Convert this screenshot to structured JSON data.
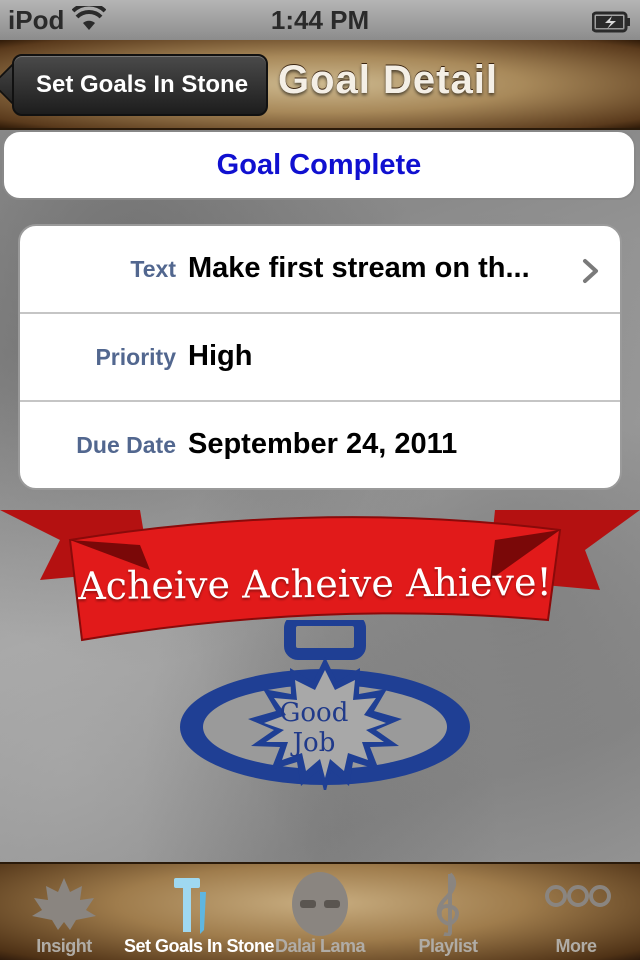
{
  "status_bar": {
    "carrier": "iPod",
    "time": "1:44 PM"
  },
  "nav": {
    "back_label": "Set Goals In Stone",
    "title": "Goal Detail"
  },
  "goal_complete_label": "Goal Complete",
  "detail": {
    "rows": [
      {
        "label": "Text",
        "value": "Make first stream on th..."
      },
      {
        "label": "Priority",
        "value": "High"
      },
      {
        "label": "Due Date",
        "value": "September 24, 2011"
      }
    ]
  },
  "banner_text": "Acheive Acheive Ahieve!",
  "medal": {
    "line1": "Good",
    "line2": "Job"
  },
  "tabs": [
    {
      "label": "Insight",
      "icon": "leaf-icon",
      "active": false
    },
    {
      "label": "Set Goals In Stone",
      "icon": "hammer-chisel-icon",
      "active": true
    },
    {
      "label": "Dalai Lama",
      "icon": "dalai-lama-icon",
      "active": false
    },
    {
      "label": "Playlist",
      "icon": "treble-clef-icon",
      "active": false
    },
    {
      "label": "More",
      "icon": "more-icon",
      "active": false
    }
  ],
  "colors": {
    "goal_complete_text": "#1010d0",
    "row_label": "#52678f",
    "banner_red": "#e11a1a",
    "medal_blue": "#1f3f94"
  }
}
